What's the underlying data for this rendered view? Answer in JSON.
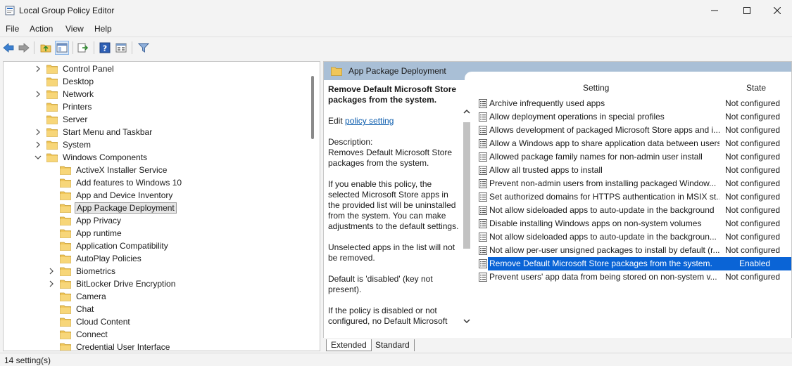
{
  "window": {
    "title": "Local Group Policy Editor"
  },
  "menu": [
    "File",
    "Action",
    "View",
    "Help"
  ],
  "toolbar": {
    "buttons": [
      "back-icon",
      "forward-icon",
      "up-folder-icon",
      "show-hide-tree-icon",
      "export-list-icon",
      "help-icon",
      "properties-icon",
      "filter-icon"
    ]
  },
  "tree": {
    "items": [
      {
        "label": "Control Panel",
        "expander": "collapsed"
      },
      {
        "label": "Desktop",
        "expander": "none"
      },
      {
        "label": "Network",
        "expander": "collapsed"
      },
      {
        "label": "Printers",
        "expander": "none"
      },
      {
        "label": "Server",
        "expander": "none"
      },
      {
        "label": "Start Menu and Taskbar",
        "expander": "collapsed"
      },
      {
        "label": "System",
        "expander": "collapsed"
      },
      {
        "label": "Windows Components",
        "expander": "expanded"
      },
      {
        "label": "ActiveX Installer Service",
        "expander": "none"
      },
      {
        "label": "Add features to Windows 10",
        "expander": "none"
      },
      {
        "label": "App and Device Inventory",
        "expander": "none"
      },
      {
        "label": "App Package Deployment",
        "expander": "none",
        "selected": true
      },
      {
        "label": "App Privacy",
        "expander": "none"
      },
      {
        "label": "App runtime",
        "expander": "none"
      },
      {
        "label": "Application Compatibility",
        "expander": "none"
      },
      {
        "label": "AutoPlay Policies",
        "expander": "none"
      },
      {
        "label": "Biometrics",
        "expander": "collapsed"
      },
      {
        "label": "BitLocker Drive Encryption",
        "expander": "collapsed"
      },
      {
        "label": "Camera",
        "expander": "none"
      },
      {
        "label": "Chat",
        "expander": "none"
      },
      {
        "label": "Cloud Content",
        "expander": "none"
      },
      {
        "label": "Connect",
        "expander": "none"
      },
      {
        "label": "Credential User Interface",
        "expander": "none"
      }
    ]
  },
  "right": {
    "header": "App Package Deployment",
    "description": {
      "title": "Remove Default Microsoft Store packages from the system.",
      "edit_prefix": "Edit ",
      "edit_link": "policy setting ",
      "desc_label": "Description:",
      "desc_text": "Removes Default Microsoft Store packages from the system.",
      "p1": "If you enable this policy, the selected Microsoft Store apps in the provided list will be uninstalled from the system. You can make adjustments to the default settings.",
      "p2": "Unselected apps in the list will not be removed.",
      "p3": "Default is 'disabled' (key not present).",
      "p4": "If the policy is disabled or not configured, no Default Microsoft"
    },
    "columns": {
      "setting": "Setting",
      "state": "State"
    },
    "rows": [
      {
        "setting": "Archive infrequently used apps",
        "state": "Not configured"
      },
      {
        "setting": "Allow deployment operations in special profiles",
        "state": "Not configured"
      },
      {
        "setting": "Allows development of packaged Microsoft Store apps and i...",
        "state": "Not configured"
      },
      {
        "setting": "Allow a Windows app to share application data between users",
        "state": "Not configured"
      },
      {
        "setting": "Allowed package family names for non-admin user install",
        "state": "Not configured"
      },
      {
        "setting": "Allow all trusted apps to install",
        "state": "Not configured"
      },
      {
        "setting": "Prevent non-admin users from installing packaged Window...",
        "state": "Not configured"
      },
      {
        "setting": "Set authorized domains for HTTPS authentication in MSIX st...",
        "state": "Not configured"
      },
      {
        "setting": "Not allow sideloaded apps to auto-update in the background",
        "state": "Not configured"
      },
      {
        "setting": "Disable installing Windows apps on non-system volumes",
        "state": "Not configured"
      },
      {
        "setting": "Not allow sideloaded apps to auto-update in the backgroun...",
        "state": "Not configured"
      },
      {
        "setting": "Not allow per-user unsigned packages to install by default (r...",
        "state": "Not configured"
      },
      {
        "setting": "Remove Default Microsoft Store packages from the system.",
        "state": "Enabled",
        "selected": true
      },
      {
        "setting": "Prevent users' app data from being stored on non-system v...",
        "state": "Not configured"
      }
    ]
  },
  "tabs": [
    "Extended",
    "Standard"
  ],
  "status": "14 setting(s)",
  "colors": {
    "selection": "#0a64d6",
    "header_band": "#a9bfd6",
    "folder": "#f0c65a",
    "link": "#0b5cad"
  }
}
